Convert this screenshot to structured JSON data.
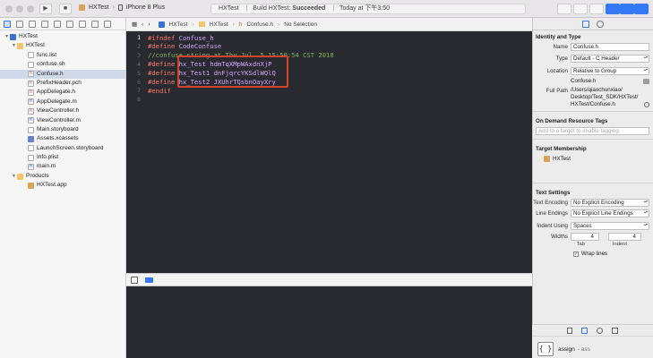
{
  "toolbar": {
    "scheme_project": "HXTest",
    "scheme_device": "iPhone 8 Plus",
    "status_project": "HXTest",
    "status_build": "Build HXTest:",
    "status_result": "Succeeded",
    "status_time": "Today at 下午3:50"
  },
  "navigator": {
    "items": [
      {
        "label": "HXTest",
        "icon": "project-icon",
        "disclosure": "▼"
      },
      {
        "label": "HXTest",
        "icon": "folder-icon",
        "disclosure": "▼"
      },
      {
        "label": "func.list",
        "icon": "file-icon",
        "disclosure": ""
      },
      {
        "label": "confuse.sh",
        "icon": "file-icon",
        "disclosure": ""
      },
      {
        "label": "Confuse.h",
        "icon": "header-file-icon",
        "disclosure": "",
        "selected": true
      },
      {
        "label": "PrefixHeader.pch",
        "icon": "header-file-icon",
        "disclosure": ""
      },
      {
        "label": "AppDelegate.h",
        "icon": "header-file-icon",
        "disclosure": ""
      },
      {
        "label": "AppDelegate.m",
        "icon": "source-file-icon",
        "disclosure": ""
      },
      {
        "label": "ViewController.h",
        "icon": "header-file-icon",
        "disclosure": ""
      },
      {
        "label": "ViewController.m",
        "icon": "source-file-icon",
        "disclosure": ""
      },
      {
        "label": "Main.storyboard",
        "icon": "storyboard-icon",
        "disclosure": ""
      },
      {
        "label": "Assets.xcassets",
        "icon": "assets-icon",
        "disclosure": ""
      },
      {
        "label": "LaunchScreen.storyboard",
        "icon": "storyboard-icon",
        "disclosure": ""
      },
      {
        "label": "Info.plist",
        "icon": "file-icon",
        "disclosure": ""
      },
      {
        "label": "main.m",
        "icon": "source-file-icon",
        "disclosure": ""
      },
      {
        "label": "Products",
        "icon": "folder-icon",
        "disclosure": "▼"
      },
      {
        "label": "HXTest.app",
        "icon": "app-icon",
        "disclosure": ""
      }
    ]
  },
  "jumpbar": {
    "crumbs": [
      "HXTest",
      "HXTest",
      "Confuse.h",
      "No Selection"
    ]
  },
  "editor": {
    "lines": [
      {
        "n": "1",
        "kw": "#ifndef",
        "rest": " Confuse_h",
        "type": "macro"
      },
      {
        "n": "2",
        "kw": "#define",
        "rest": " CodeConfuse",
        "type": "macro"
      },
      {
        "n": "3",
        "kw": "",
        "rest": "//confuse string at Thu Jul  5 15:50:54 CST 2018",
        "type": "comment"
      },
      {
        "n": "4",
        "kw": "#define",
        "rest": " hx_Test hdmTqXMpWAxdnXjP",
        "type": "macro"
      },
      {
        "n": "5",
        "kw": "#define",
        "rest": " hx_Test1 dnFjqrcYKSdlWQlQ",
        "type": "macro"
      },
      {
        "n": "6",
        "kw": "#define",
        "rest": " hx_Test2 JXUhrTQsbnOayXry",
        "type": "macro"
      },
      {
        "n": "7",
        "kw": "#endif",
        "rest": "",
        "type": "macro"
      },
      {
        "n": "8",
        "kw": "",
        "rest": "",
        "type": "empty"
      }
    ],
    "highlight_color": "#d2452c"
  },
  "inspector": {
    "identity_title": "Identity and Type",
    "name_label": "Name",
    "name_value": "Confuse.h",
    "type_label": "Type",
    "type_value": "Default - C Header",
    "location_label": "Location",
    "location_value": "Relative to Group",
    "location_file": "Confuse.h",
    "fullpath_label": "Full Path",
    "fullpath_value_1": "/Users/qiaochunxiao/",
    "fullpath_value_2": "Desktop/Test_SDK/HXTest/",
    "fullpath_value_3": "HXTest/Confuse.h",
    "odr_title": "On Demand Resource Tags",
    "odr_placeholder": "Add to a target to enable tagging",
    "target_title": "Target Membership",
    "target_name": "HXTest",
    "text_title": "Text Settings",
    "encoding_label": "Text Encoding",
    "encoding_value": "No Explicit Encoding",
    "endings_label": "Line Endings",
    "endings_value": "No Explicit Line Endings",
    "indent_label": "Indent Using",
    "indent_value": "Spaces",
    "widths_label": "Widths",
    "tab_value": "4",
    "indent_width_value": "4",
    "tab_caption": "Tab",
    "indent_caption": "Indent",
    "wrap_label": "Wrap lines"
  },
  "library": {
    "item_name": "assign",
    "item_sub": "- ass"
  }
}
